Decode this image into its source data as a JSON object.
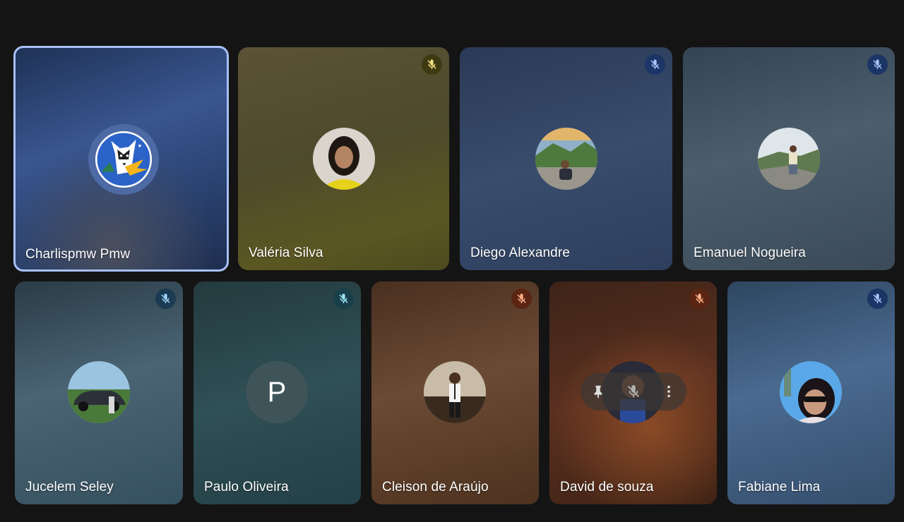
{
  "participants": [
    {
      "name": "Charlispmw Pmw",
      "avatar": "husky-logo-icon",
      "muted": false,
      "active": true,
      "bg": "#2f4a7c"
    },
    {
      "name": "Valéria Silva",
      "avatar": "photo-woman-yellow",
      "muted": true,
      "mute_color": "#f2e384",
      "bg": "#4d4826"
    },
    {
      "name": "Diego Alexandre",
      "avatar": "photo-man-mountain",
      "muted": true,
      "mute_color": "#aac4ff",
      "bg": "#2f3f5c"
    },
    {
      "name": "Emanuel Nogueira",
      "avatar": "photo-man-cliff",
      "muted": true,
      "mute_color": "#aac4ff",
      "bg": "#3c4a56"
    },
    {
      "name": "Jucelem Seley",
      "avatar": "photo-car",
      "muted": true,
      "mute_color": "#9fd4ff",
      "bg": "#2f4654"
    },
    {
      "name": "Paulo Oliveira",
      "avatar_letter": "P",
      "muted": true,
      "mute_color": "#9fe6f5",
      "bg": "#24444a"
    },
    {
      "name": "Cleison de Araújo",
      "avatar": "photo-man-suit",
      "muted": true,
      "mute_color": "#ffb08a",
      "bg": "#5a3a26"
    },
    {
      "name": "David de souza",
      "avatar": "photo-man-dark",
      "muted": true,
      "mute_color": "#ffb08a",
      "bg": "#4f2c1a"
    },
    {
      "name": "Fabiane Lima",
      "avatar": "photo-woman-sunglasses",
      "muted": true,
      "mute_color": "#aac4ff",
      "bg": "#36506e"
    }
  ],
  "hover_controls": {
    "items": [
      "pin-icon",
      "mute-other-icon",
      "more-options-icon"
    ]
  },
  "colors": {
    "background": "#141414",
    "active_border": "#a8c0f5"
  }
}
